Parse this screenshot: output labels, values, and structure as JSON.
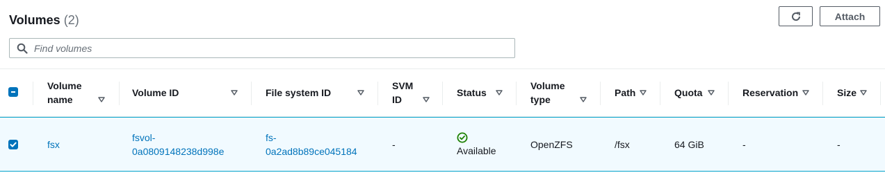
{
  "header": {
    "title": "Volumes",
    "count": "(2)",
    "refresh_icon": "refresh-icon",
    "attach_label": "Attach"
  },
  "search": {
    "placeholder": "Find volumes",
    "value": "",
    "icon": "search-icon"
  },
  "table": {
    "columns": [
      {
        "key": "select",
        "label": ""
      },
      {
        "key": "volume_name",
        "label_line1": "Volume",
        "label_line2": "name"
      },
      {
        "key": "volume_id",
        "label": "Volume ID"
      },
      {
        "key": "file_system_id",
        "label": "File system ID"
      },
      {
        "key": "svm_id",
        "label_line1": "SVM",
        "label_line2": "ID"
      },
      {
        "key": "status",
        "label": "Status"
      },
      {
        "key": "volume_type",
        "label_line1": "Volume",
        "label_line2": "type"
      },
      {
        "key": "path",
        "label": "Path"
      },
      {
        "key": "quota",
        "label": "Quota"
      },
      {
        "key": "reservation",
        "label": "Reservation"
      },
      {
        "key": "size",
        "label": "Size"
      }
    ],
    "rows": [
      {
        "selected": true,
        "volume_name": "fsx",
        "volume_id_line1": "fsvol-",
        "volume_id_line2": "0a0809148238d998e",
        "file_system_id_line1": "fs-",
        "file_system_id_line2": "0a2ad8b89ce045184",
        "svm_id": "-",
        "status": "Available",
        "status_icon": "check-circle-icon",
        "volume_type": "OpenZFS",
        "path": "/fsx",
        "quota": "64 GiB",
        "reservation": "-",
        "size": "-"
      }
    ]
  },
  "colors": {
    "link": "#0073bb",
    "success": "#1d8102",
    "selected_row_bg": "#f1faff",
    "selected_row_border": "#00a1c9"
  }
}
